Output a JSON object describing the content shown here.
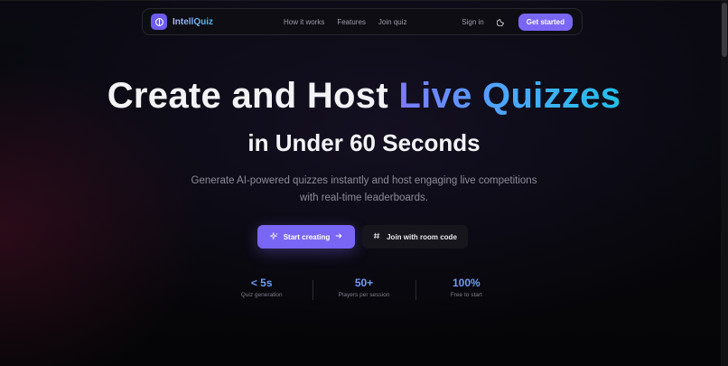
{
  "nav": {
    "brand": "IntellQuiz",
    "links": [
      "How it works",
      "Features",
      "Join quiz"
    ],
    "signin": "Sign in",
    "cta": "Get started"
  },
  "hero": {
    "title_start": "Create and Host ",
    "title_accent": "Live Quizzes",
    "subtitle": "in Under 60 Seconds",
    "description": "Generate AI-powered quizzes instantly and host engaging live competitions with real-time leaderboards.",
    "primary_cta": "Start creating",
    "secondary_cta": "Join with room code"
  },
  "stats": [
    {
      "value": "< 5s",
      "label": "Quiz generation"
    },
    {
      "value": "50+",
      "label": "Players per session"
    },
    {
      "value": "100%",
      "label": "Free to start"
    }
  ],
  "icons": {
    "brand": "brain-icon",
    "theme": "moon-icon",
    "start": "sparkles-icon",
    "arrow": "arrow-right-icon",
    "join": "hash-icon"
  },
  "colors": {
    "accent": "#7a66f5",
    "accent_gradient_start": "#7d79ff",
    "accent_gradient_end": "#22c0e8"
  }
}
